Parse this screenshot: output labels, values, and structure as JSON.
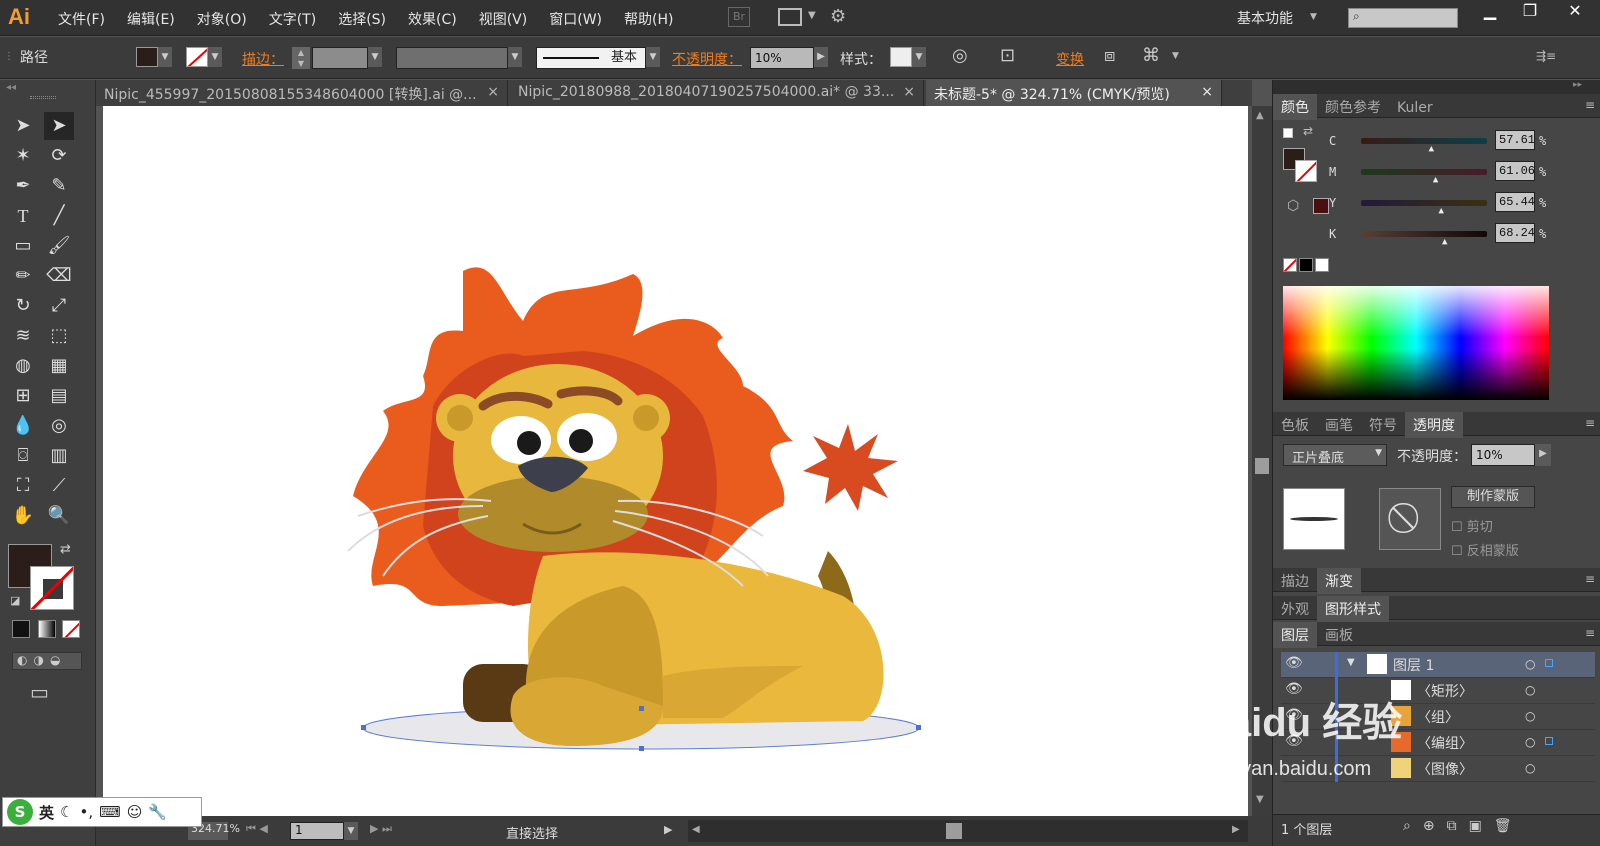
{
  "app": {
    "logo": "Ai",
    "workspace": "基本功能",
    "bridge": "Br"
  },
  "menu": [
    "文件(F)",
    "编辑(E)",
    "对象(O)",
    "文字(T)",
    "选择(S)",
    "效果(C)",
    "视图(V)",
    "窗口(W)",
    "帮助(H)"
  ],
  "control": {
    "selection_type": "路径",
    "stroke_label": "描边：",
    "opacity_label": "不透明度：",
    "opacity_value": "10%",
    "brush_label": "基本",
    "style_label": "样式：",
    "transform_label": "变换"
  },
  "tabs": [
    {
      "label": "Nipic_455997_20150808155348604000 [转换].ai @...",
      "close": "×"
    },
    {
      "label": "Nipic_20180988_20180407190257504000.ai* @ 33...",
      "close": "×"
    },
    {
      "label": "未标题-5* @ 324.71% (CMYK/预览)",
      "close": "×"
    }
  ],
  "color_panel": {
    "tabs": [
      "颜色",
      "颜色参考",
      "Kuler"
    ],
    "channels": [
      {
        "name": "C",
        "value": "57.61",
        "unit": "%",
        "level": 0.5761
      },
      {
        "name": "M",
        "value": "61.06",
        "unit": "%",
        "level": 0.6106
      },
      {
        "name": "Y",
        "value": "65.44",
        "unit": "%",
        "level": 0.6544
      },
      {
        "name": "K",
        "value": "68.24",
        "unit": "%",
        "level": 0.6824
      }
    ],
    "fill_color": "#2a1d1a"
  },
  "transparency_panel": {
    "tabs": [
      "色板",
      "画笔",
      "符号",
      "透明度"
    ],
    "blend_mode": "正片叠底",
    "opacity_label": "不透明度：",
    "opacity_value": "10%",
    "make_mask": "制作蒙版",
    "clip": "剪切",
    "invert_mask": "反相蒙版"
  },
  "stroke_gradient_tabs": [
    "描边",
    "渐变"
  ],
  "appearance_tabs": [
    "外观",
    "图形样式"
  ],
  "layers_panel": {
    "tabs": [
      "图层",
      "画板"
    ],
    "rows": [
      "图层 1",
      "〈矩形〉",
      "〈组〉",
      "〈编组〉",
      "〈图像〉"
    ],
    "footer": "1 个图层"
  },
  "status": {
    "zoom": "324.71%",
    "page": "1",
    "tool": "直接选择"
  },
  "ime": {
    "lang": "英"
  },
  "watermark": {
    "brand": "Baidu 经验",
    "url": "jingyan.baidu.com"
  }
}
